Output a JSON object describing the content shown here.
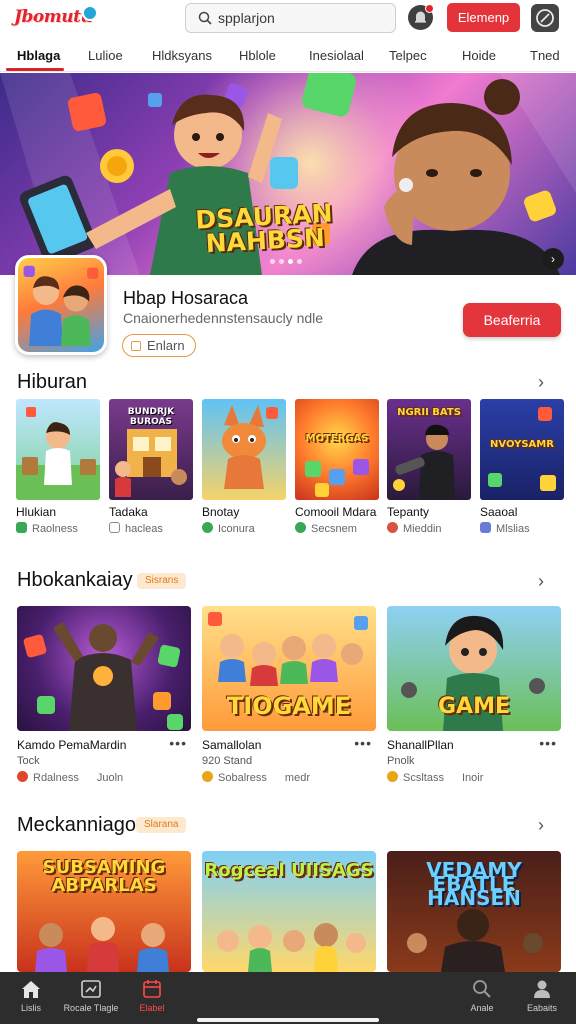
{
  "app": {
    "logo_text": "Jbomutu"
  },
  "header": {
    "search_placeholder": "spplarjon",
    "cta_label": "Elemenp"
  },
  "tabs": [
    {
      "label": "Hblaga",
      "active": true
    },
    {
      "label": "Lulioe"
    },
    {
      "label": "Hldksyans"
    },
    {
      "label": "Hblole"
    },
    {
      "label": "Inesiolaal"
    },
    {
      "label": "Telpec"
    },
    {
      "label": "Hoide"
    },
    {
      "label": "Tned"
    }
  ],
  "hero": {
    "title_line1": "DSAURAN",
    "title_line2": "NAHBSN",
    "dot_count": 4,
    "active_dot": 2
  },
  "featured": {
    "name": "Hbap Hosaraca",
    "description": "Cnaionerhedennstensaucly ndle",
    "tag": "Enlarn",
    "button_label": "Beaferria"
  },
  "section1": {
    "title": "Hiburan",
    "items": [
      {
        "name": "Hlukian",
        "meta": "Raolness",
        "meta_color": "#3aa657"
      },
      {
        "name": "Tadaka",
        "meta": "hacleas",
        "meta_color": "#888888",
        "art_text": "BUNDRJK BUROAS"
      },
      {
        "name": "Bnotay",
        "meta": "Iconura",
        "meta_color": "#3aa657"
      },
      {
        "name": "Comooil Mdara",
        "meta": "Secsnem",
        "meta_color": "#3aa657",
        "art_text": "MOTERGAS"
      },
      {
        "name": "Tepanty",
        "meta": "Mieddin",
        "meta_color": "#d9533e",
        "art_text": "NGRII BATS"
      },
      {
        "name": "Saaoal",
        "meta": "Mlslias",
        "meta_color": "#6a7bd6",
        "art_text": "NVOYSAMR"
      }
    ]
  },
  "section2": {
    "title": "Hbokankaiay",
    "badge": "Sisrans",
    "items": [
      {
        "title": "Kamdo PemaMardin",
        "sub": "Tock",
        "meta1": "Rdalness",
        "meta2": "Juoln",
        "meta_color": "#e0472c"
      },
      {
        "title": "Samallolan",
        "sub": "920 Stand",
        "meta1": "Sobalress",
        "meta2": "medr",
        "meta_color": "#e8a516",
        "art_text": "TIOGAME"
      },
      {
        "title": "ShanallPllan",
        "sub": "Pnolk",
        "meta1": "Scsltass",
        "meta2": "Inoir",
        "meta_color": "#e8a516",
        "art_text": "GAME"
      }
    ]
  },
  "section3": {
    "title": "Meckanniago",
    "badge": "Slarana",
    "items": [
      {
        "art_text": "SUBSAMING ABPARLAS"
      },
      {
        "art_text": "Rogceal UIISAGS"
      },
      {
        "art_text": "VEDAMY EBATLE HANSEN"
      }
    ]
  },
  "bottom_nav": [
    {
      "label": "Lislis",
      "icon": "home-icon"
    },
    {
      "label": "Rocale Tlagle",
      "icon": "gamepad-icon"
    },
    {
      "label": "Elabel",
      "icon": "calendar-icon",
      "active": true
    },
    {
      "label": "Anale",
      "icon": "search-icon"
    },
    {
      "label": "Eabaits",
      "icon": "person-icon"
    }
  ],
  "colors": {
    "accent": "#e3353c",
    "nav_bg": "#2d2d2d",
    "badge_bg": "#fde9d0",
    "badge_text": "#e07a18"
  }
}
